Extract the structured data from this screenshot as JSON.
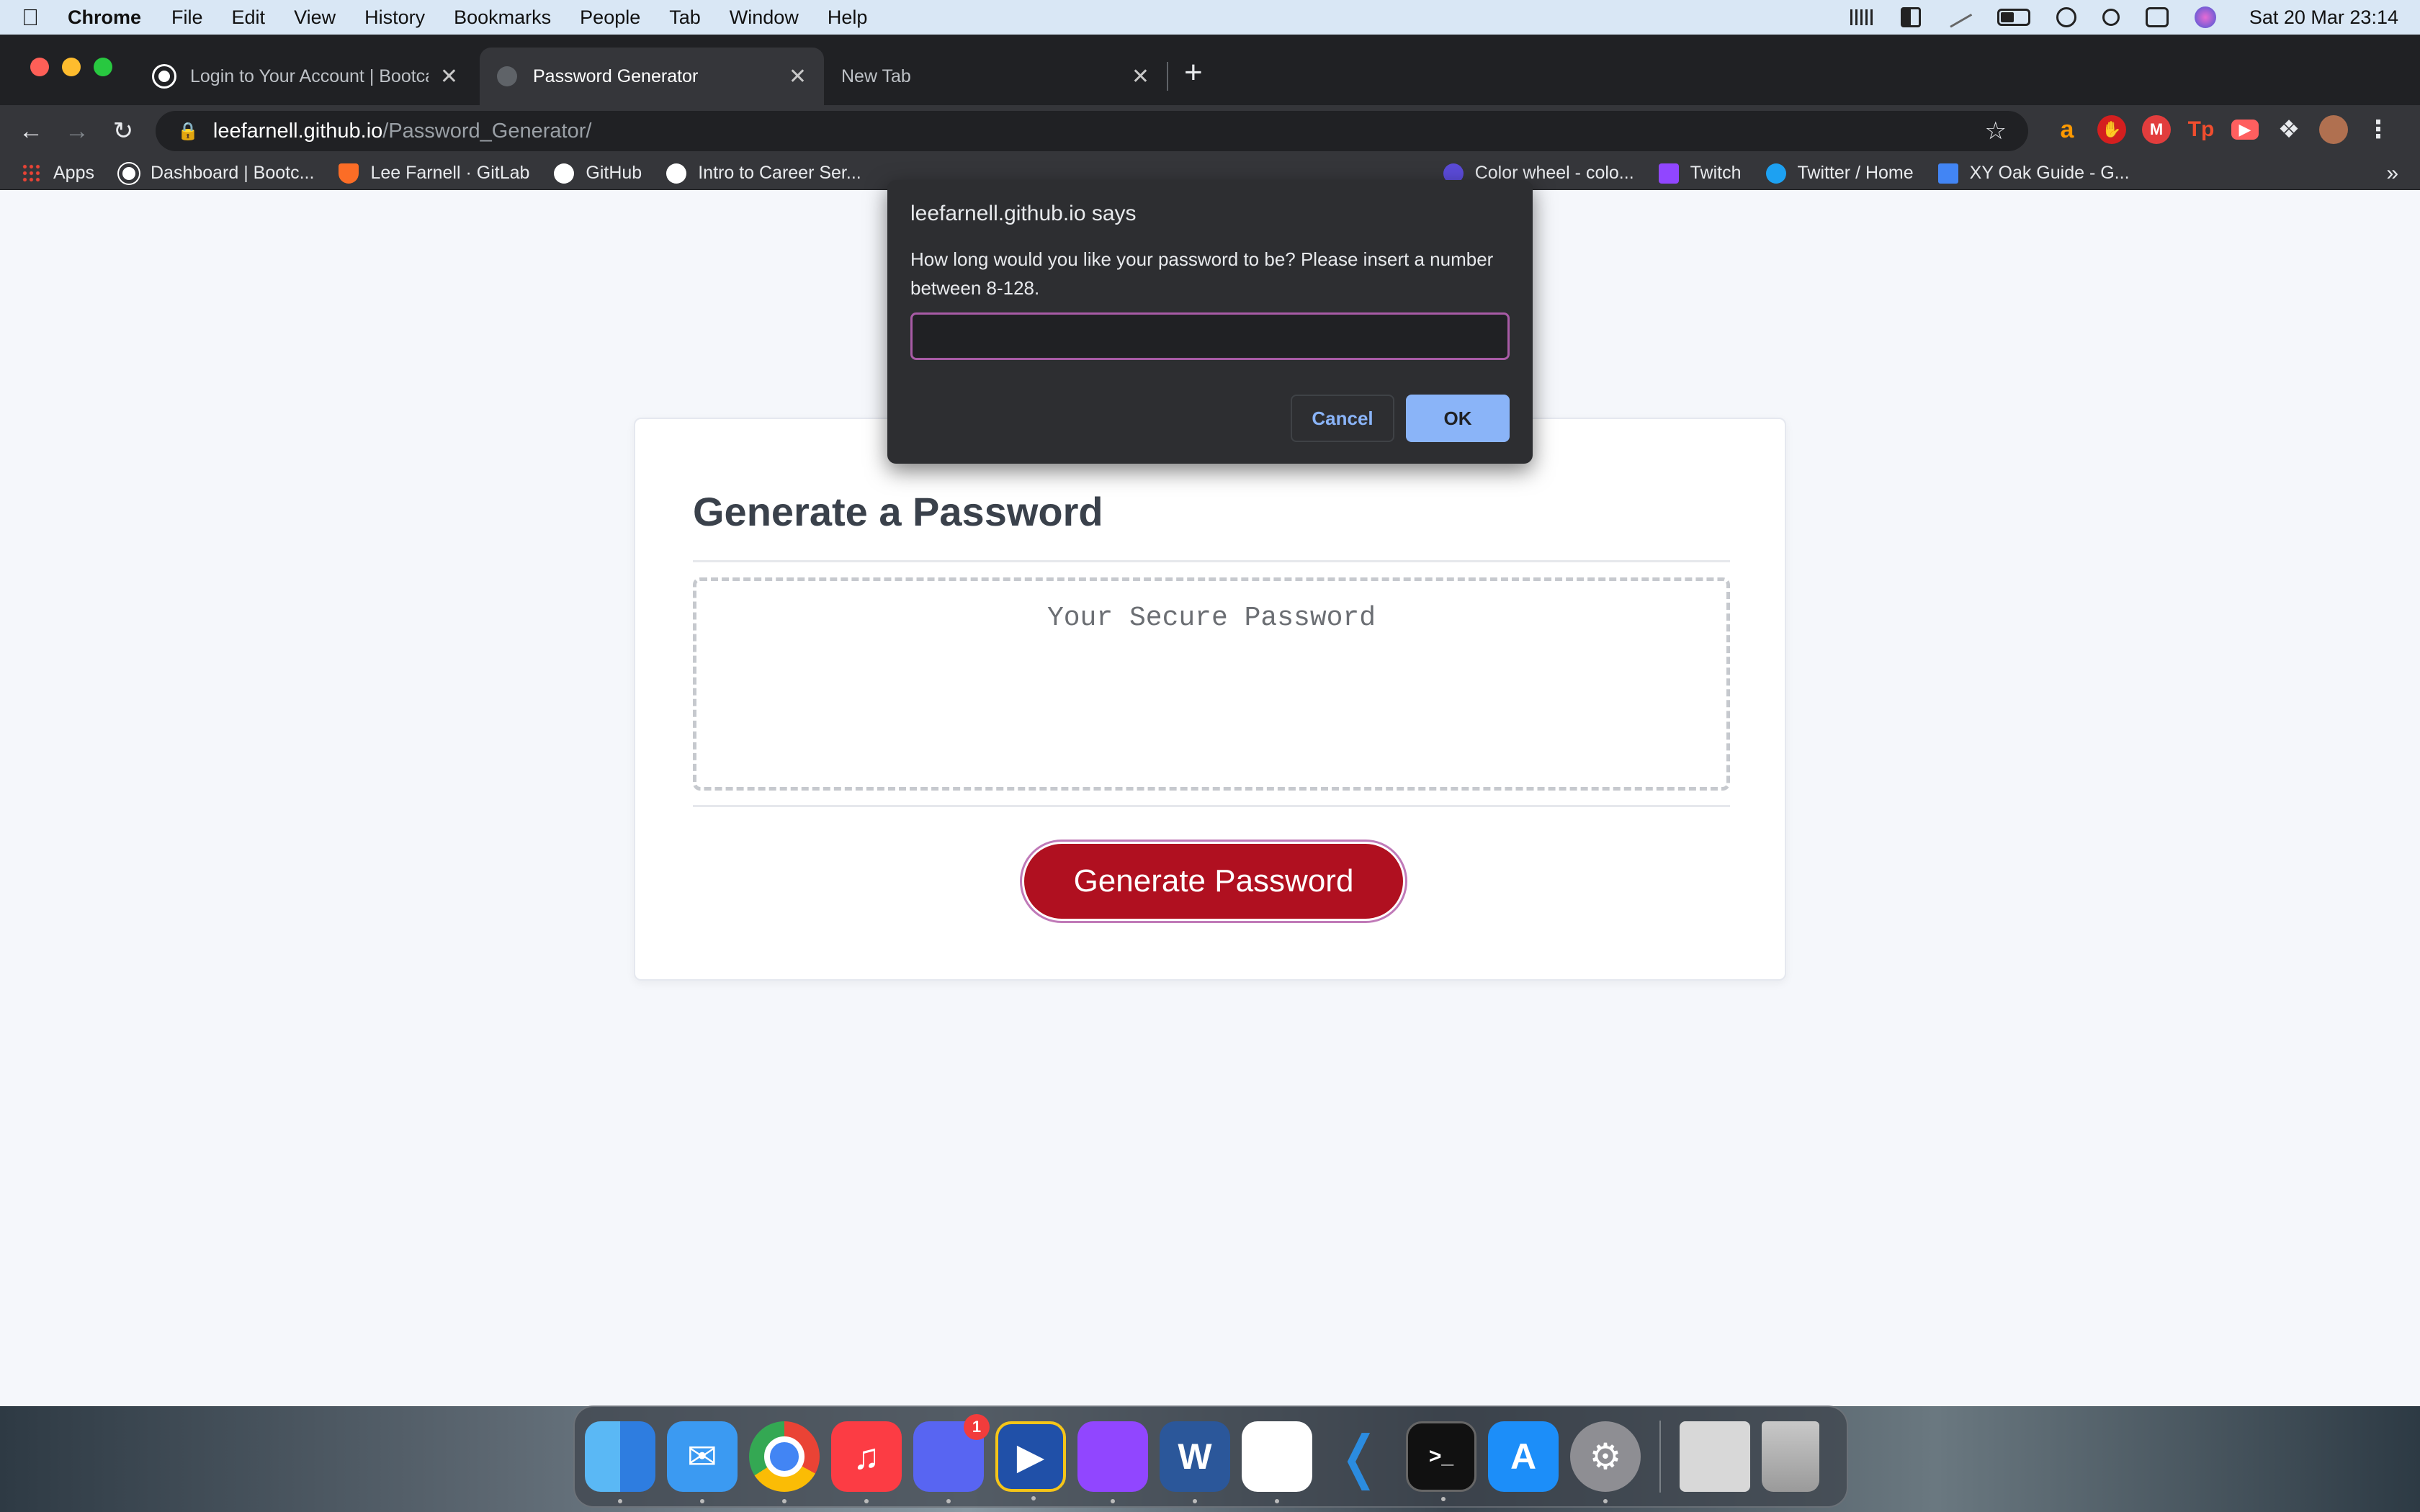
{
  "menubar": {
    "apple": "",
    "app_name": "Chrome",
    "menus": [
      "File",
      "Edit",
      "View",
      "History",
      "Bookmarks",
      "People",
      "Tab",
      "Window",
      "Help"
    ],
    "datetime": "Sat 20 Mar  23:14"
  },
  "tabs": [
    {
      "title": "Login to Your Account | Bootca",
      "close": "✕"
    },
    {
      "title": "Password Generator",
      "close": "✕"
    },
    {
      "title": "New Tab",
      "close": "✕"
    }
  ],
  "toolbar": {
    "back": "←",
    "forward": "→",
    "reload": "↻",
    "url_host": "leefarnell.github.io",
    "url_path": "/Password_Generator/",
    "star": "☆",
    "new_tab": "+"
  },
  "bookmarks": [
    "Apps",
    "Dashboard | Bootc...",
    "Lee Farnell · GitLab",
    "GitHub",
    "Intro to Career Ser...",
    "Color wheel - colo...",
    "Twitch",
    "Twitter / Home",
    "XY Oak Guide - G..."
  ],
  "bookmarks_more": "»",
  "page": {
    "title": "Generate a Password",
    "password_placeholder": "Your Secure Password",
    "generate_button": "Generate Password"
  },
  "dialog": {
    "title": "leefarnell.github.io says",
    "message": "How long would you like your password to be? Please insert a number between 8-128.",
    "input_value": "",
    "cancel": "Cancel",
    "ok": "OK"
  },
  "dock": {
    "discord_badge": "1",
    "word_letter": "W",
    "terminal_text": ">_"
  },
  "colors": {
    "generate_button": "#b01020",
    "dialog_ok": "#8ab4f8",
    "dialog_bg": "#2d2e31"
  }
}
